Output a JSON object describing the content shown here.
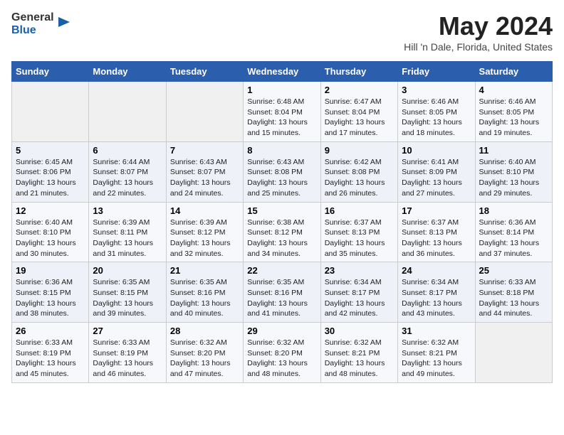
{
  "header": {
    "logo_general": "General",
    "logo_blue": "Blue",
    "title": "May 2024",
    "subtitle": "Hill 'n Dale, Florida, United States"
  },
  "days_of_week": [
    "Sunday",
    "Monday",
    "Tuesday",
    "Wednesday",
    "Thursday",
    "Friday",
    "Saturday"
  ],
  "weeks": [
    [
      {
        "day": "",
        "info": ""
      },
      {
        "day": "",
        "info": ""
      },
      {
        "day": "",
        "info": ""
      },
      {
        "day": "1",
        "info": "Sunrise: 6:48 AM\nSunset: 8:04 PM\nDaylight: 13 hours\nand 15 minutes."
      },
      {
        "day": "2",
        "info": "Sunrise: 6:47 AM\nSunset: 8:04 PM\nDaylight: 13 hours\nand 17 minutes."
      },
      {
        "day": "3",
        "info": "Sunrise: 6:46 AM\nSunset: 8:05 PM\nDaylight: 13 hours\nand 18 minutes."
      },
      {
        "day": "4",
        "info": "Sunrise: 6:46 AM\nSunset: 8:05 PM\nDaylight: 13 hours\nand 19 minutes."
      }
    ],
    [
      {
        "day": "5",
        "info": "Sunrise: 6:45 AM\nSunset: 8:06 PM\nDaylight: 13 hours\nand 21 minutes."
      },
      {
        "day": "6",
        "info": "Sunrise: 6:44 AM\nSunset: 8:07 PM\nDaylight: 13 hours\nand 22 minutes."
      },
      {
        "day": "7",
        "info": "Sunrise: 6:43 AM\nSunset: 8:07 PM\nDaylight: 13 hours\nand 24 minutes."
      },
      {
        "day": "8",
        "info": "Sunrise: 6:43 AM\nSunset: 8:08 PM\nDaylight: 13 hours\nand 25 minutes."
      },
      {
        "day": "9",
        "info": "Sunrise: 6:42 AM\nSunset: 8:08 PM\nDaylight: 13 hours\nand 26 minutes."
      },
      {
        "day": "10",
        "info": "Sunrise: 6:41 AM\nSunset: 8:09 PM\nDaylight: 13 hours\nand 27 minutes."
      },
      {
        "day": "11",
        "info": "Sunrise: 6:40 AM\nSunset: 8:10 PM\nDaylight: 13 hours\nand 29 minutes."
      }
    ],
    [
      {
        "day": "12",
        "info": "Sunrise: 6:40 AM\nSunset: 8:10 PM\nDaylight: 13 hours\nand 30 minutes."
      },
      {
        "day": "13",
        "info": "Sunrise: 6:39 AM\nSunset: 8:11 PM\nDaylight: 13 hours\nand 31 minutes."
      },
      {
        "day": "14",
        "info": "Sunrise: 6:39 AM\nSunset: 8:12 PM\nDaylight: 13 hours\nand 32 minutes."
      },
      {
        "day": "15",
        "info": "Sunrise: 6:38 AM\nSunset: 8:12 PM\nDaylight: 13 hours\nand 34 minutes."
      },
      {
        "day": "16",
        "info": "Sunrise: 6:37 AM\nSunset: 8:13 PM\nDaylight: 13 hours\nand 35 minutes."
      },
      {
        "day": "17",
        "info": "Sunrise: 6:37 AM\nSunset: 8:13 PM\nDaylight: 13 hours\nand 36 minutes."
      },
      {
        "day": "18",
        "info": "Sunrise: 6:36 AM\nSunset: 8:14 PM\nDaylight: 13 hours\nand 37 minutes."
      }
    ],
    [
      {
        "day": "19",
        "info": "Sunrise: 6:36 AM\nSunset: 8:15 PM\nDaylight: 13 hours\nand 38 minutes."
      },
      {
        "day": "20",
        "info": "Sunrise: 6:35 AM\nSunset: 8:15 PM\nDaylight: 13 hours\nand 39 minutes."
      },
      {
        "day": "21",
        "info": "Sunrise: 6:35 AM\nSunset: 8:16 PM\nDaylight: 13 hours\nand 40 minutes."
      },
      {
        "day": "22",
        "info": "Sunrise: 6:35 AM\nSunset: 8:16 PM\nDaylight: 13 hours\nand 41 minutes."
      },
      {
        "day": "23",
        "info": "Sunrise: 6:34 AM\nSunset: 8:17 PM\nDaylight: 13 hours\nand 42 minutes."
      },
      {
        "day": "24",
        "info": "Sunrise: 6:34 AM\nSunset: 8:17 PM\nDaylight: 13 hours\nand 43 minutes."
      },
      {
        "day": "25",
        "info": "Sunrise: 6:33 AM\nSunset: 8:18 PM\nDaylight: 13 hours\nand 44 minutes."
      }
    ],
    [
      {
        "day": "26",
        "info": "Sunrise: 6:33 AM\nSunset: 8:19 PM\nDaylight: 13 hours\nand 45 minutes."
      },
      {
        "day": "27",
        "info": "Sunrise: 6:33 AM\nSunset: 8:19 PM\nDaylight: 13 hours\nand 46 minutes."
      },
      {
        "day": "28",
        "info": "Sunrise: 6:32 AM\nSunset: 8:20 PM\nDaylight: 13 hours\nand 47 minutes."
      },
      {
        "day": "29",
        "info": "Sunrise: 6:32 AM\nSunset: 8:20 PM\nDaylight: 13 hours\nand 48 minutes."
      },
      {
        "day": "30",
        "info": "Sunrise: 6:32 AM\nSunset: 8:21 PM\nDaylight: 13 hours\nand 48 minutes."
      },
      {
        "day": "31",
        "info": "Sunrise: 6:32 AM\nSunset: 8:21 PM\nDaylight: 13 hours\nand 49 minutes."
      },
      {
        "day": "",
        "info": ""
      }
    ]
  ]
}
